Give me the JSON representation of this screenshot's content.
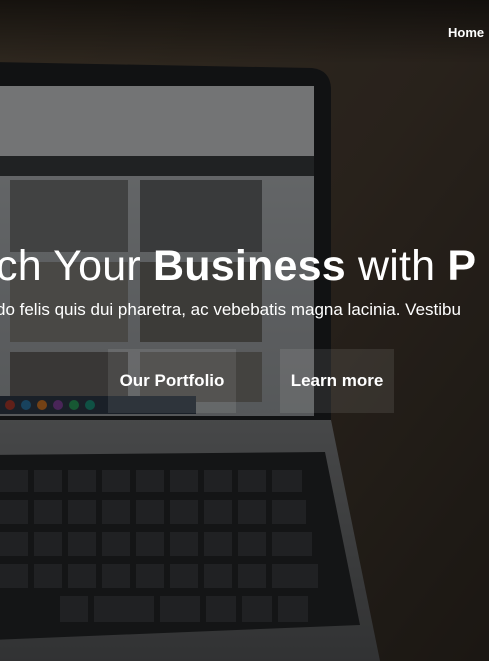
{
  "nav": {
    "home_label": "Home"
  },
  "hero": {
    "headline_part1": "ch Your ",
    "headline_bold": "Business",
    "headline_part2": " with ",
    "headline_part3": "P",
    "subtitle": "do felis quis dui pharetra, ac vebebatis magna lacinia. Vestibu",
    "buttons": {
      "portfolio_label": "Our Portfolio",
      "learn_more_label": "Learn more"
    }
  },
  "colors": {
    "text": "#ffffff",
    "button_bg": "rgba(255,255,255,0.09)",
    "overlay": "rgba(10,10,10,0.52)"
  }
}
